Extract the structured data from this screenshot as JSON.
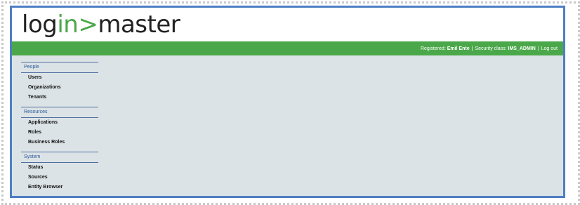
{
  "app": {
    "logo": {
      "part1": "log",
      "part2": "in>",
      "part3": "master"
    },
    "status": {
      "registered_label": "Registered:",
      "user": "Emil Ente",
      "sep1": "|",
      "security_label": "Security class:",
      "security_class": "IMS_ADMIN",
      "sep2": "|",
      "logout": "Log out"
    }
  },
  "sidebar": {
    "sections": [
      {
        "title": "People",
        "items": [
          "Users",
          "Organizations",
          "Tenants"
        ]
      },
      {
        "title": "Resources",
        "items": [
          "Applications",
          "Roles",
          "Business Roles"
        ]
      },
      {
        "title": "System",
        "items": [
          "Status",
          "Sources",
          "Entity Browser"
        ]
      }
    ]
  },
  "colors": {
    "brand_green": "#4ba84a",
    "frame_blue": "#4f7ec4",
    "content_bg": "#dce3e6"
  }
}
